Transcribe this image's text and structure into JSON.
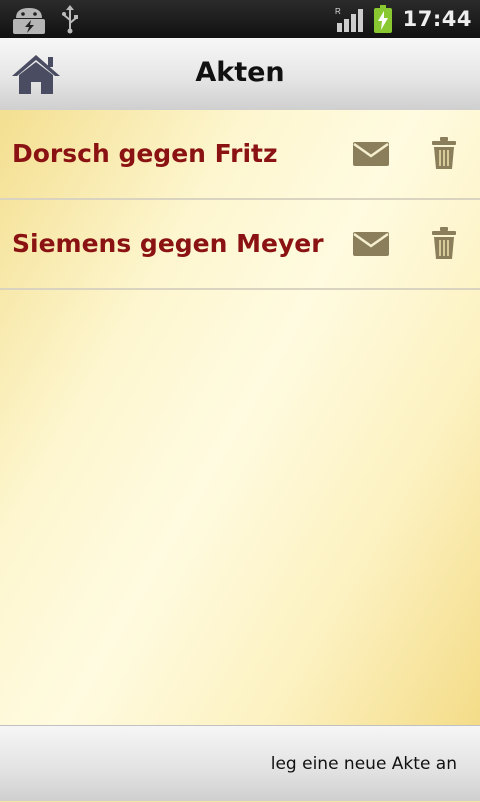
{
  "status_bar": {
    "time": "17:44",
    "icons": [
      "android-debug-icon",
      "usb-icon",
      "signal-icon",
      "battery-charging-icon"
    ],
    "roaming_label": "R"
  },
  "header": {
    "title": "Akten",
    "home_icon": "home-icon"
  },
  "list": {
    "items": [
      {
        "label": "Dorsch gegen Fritz"
      },
      {
        "label": "Siemens gegen Meyer"
      }
    ],
    "row_icons": [
      "mail-icon",
      "trash-icon"
    ]
  },
  "footer": {
    "new_label": "leg eine neue Akte an"
  },
  "colors": {
    "item_text": "#8a1212",
    "icon": "#8a7f5a",
    "home_icon": "#4a4d62",
    "battery": "#8ac832"
  }
}
